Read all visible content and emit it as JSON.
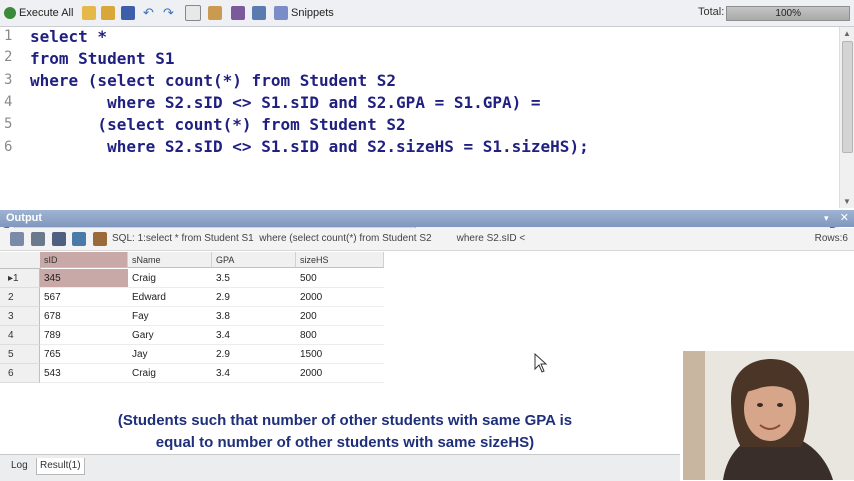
{
  "toolbar": {
    "execute_all": "Execute All",
    "snippets": "Snippets",
    "total_label": "Total:",
    "total_percent_text": "100%",
    "total_progress": 1.0
  },
  "editor": {
    "lines": [
      {
        "num": "1",
        "text": "select *"
      },
      {
        "num": "2",
        "text": "from Student S1"
      },
      {
        "num": "3",
        "text": "where (select count(*) from Student S2"
      },
      {
        "num": "4",
        "text": "        where S2.sID <> S1.sID and S2.GPA = S1.GPA) ="
      },
      {
        "num": "5",
        "text": "       (select count(*) from Student S2"
      },
      {
        "num": "6",
        "text": "        where S2.sID <> S1.sID and S2.sizeHS = S1.sizeHS);"
      }
    ]
  },
  "output": {
    "title": "Output",
    "sql_text": "SQL: 1:select * from Student S1  where (select count(*) from Student S2         where S2.sID <",
    "rows_text": "Rows:6"
  },
  "grid": {
    "columns": [
      "sID",
      "sName",
      "GPA",
      "sizeHS"
    ],
    "rows": [
      {
        "num": "1",
        "cells": [
          "345",
          "Craig",
          "3.5",
          "500"
        ]
      },
      {
        "num": "2",
        "cells": [
          "567",
          "Edward",
          "2.9",
          "2000"
        ]
      },
      {
        "num": "3",
        "cells": [
          "678",
          "Fay",
          "3.8",
          "200"
        ]
      },
      {
        "num": "4",
        "cells": [
          "789",
          "Gary",
          "3.4",
          "800"
        ]
      },
      {
        "num": "5",
        "cells": [
          "765",
          "Jay",
          "2.9",
          "1500"
        ]
      },
      {
        "num": "6",
        "cells": [
          "543",
          "Craig",
          "3.4",
          "2000"
        ]
      }
    ]
  },
  "caption": {
    "line1": "(Students such that number of other students with same GPA is",
    "line2": "equal to number of other students with same sizeHS)"
  },
  "tabs": {
    "log": "Log",
    "result": "Result(1)"
  },
  "colors": {
    "keyword": "#202080",
    "selected_cell": "#c9a8a8",
    "output_header": "#8aa1c6",
    "caption": "#1f2f7a"
  }
}
